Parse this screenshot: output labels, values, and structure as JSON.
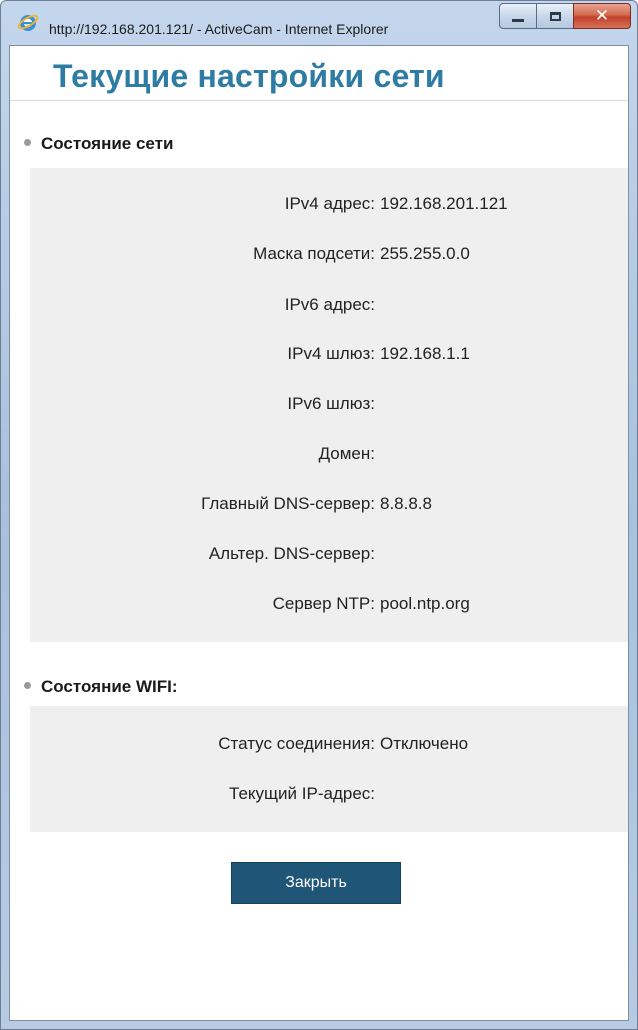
{
  "window": {
    "title": "http://192.168.201.121/ - ActiveCam - Internet Explorer",
    "icon": "internet-explorer-icon"
  },
  "page": {
    "title": "Текущие настройки сети"
  },
  "network": {
    "heading": "Состояние сети",
    "rows": [
      {
        "label": "IPv4 адрес:",
        "value": "192.168.201.121"
      },
      {
        "label": "Маска подсети:",
        "value": "255.255.0.0"
      },
      {
        "label": "IPv6 адрес:",
        "value": ""
      },
      {
        "label": "IPv4 шлюз:",
        "value": "192.168.1.1"
      },
      {
        "label": "IPv6 шлюз:",
        "value": ""
      },
      {
        "label": "Домен:",
        "value": ""
      },
      {
        "label": "Главный DNS-сервер:",
        "value": "8.8.8.8"
      },
      {
        "label": "Альтер. DNS-сервер:",
        "value": ""
      },
      {
        "label": "Сервер NTP:",
        "value": "pool.ntp.org"
      }
    ]
  },
  "wifi": {
    "heading": "Состояние WIFI:",
    "rows": [
      {
        "label": "Статус соединения:",
        "value": "Отключено"
      },
      {
        "label": "Текущий IP-адрес:",
        "value": ""
      }
    ]
  },
  "actions": {
    "close_label": "Закрыть"
  },
  "colors": {
    "title": "#2e7ca3",
    "button": "#1f5577",
    "panel": "#efefef"
  }
}
